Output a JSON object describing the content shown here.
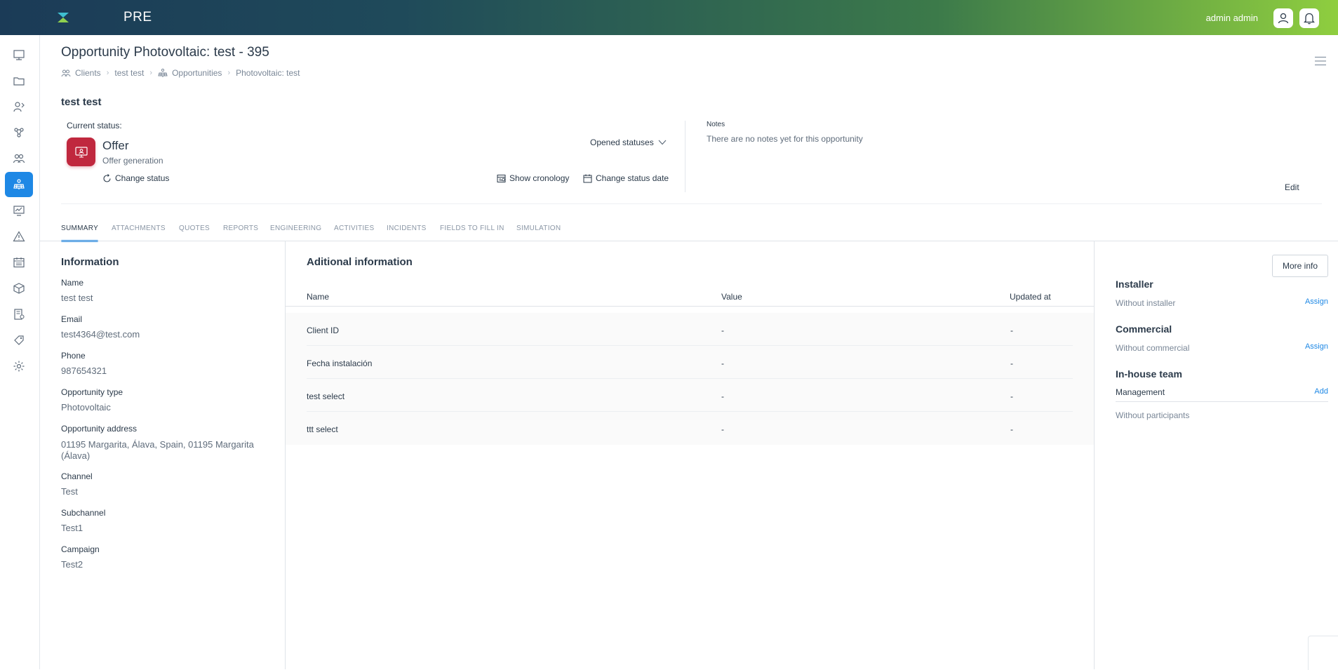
{
  "topbar": {
    "brand": "PRE",
    "user_name": "admin admin"
  },
  "sidebar": {
    "items": [
      {
        "icon": "dashboard-icon"
      },
      {
        "icon": "folder-icon"
      },
      {
        "icon": "leads-icon"
      },
      {
        "icon": "network-icon"
      },
      {
        "icon": "clients-icon"
      },
      {
        "icon": "solar-panel-icon",
        "active": true
      },
      {
        "icon": "monitor-icon"
      },
      {
        "icon": "warning-icon"
      },
      {
        "icon": "calendar-icon"
      },
      {
        "icon": "box-icon"
      },
      {
        "icon": "invoice-icon"
      },
      {
        "icon": "tag-icon"
      },
      {
        "icon": "settings-icon"
      }
    ]
  },
  "header": {
    "title": "Opportunity Photovoltaic: test - 395",
    "breadcrumb": [
      "Clients",
      "test test",
      "Opportunities",
      "Photovoltaic: test"
    ],
    "client_name": "test test"
  },
  "status": {
    "current_label": "Current status:",
    "name": "Offer",
    "sub": "Offer generation",
    "change_status": "Change status",
    "opened_statuses": "Opened statuses",
    "show_cronology": "Show cronology",
    "change_status_date": "Change status date",
    "color": "#c0283e"
  },
  "notes": {
    "label": "Notes",
    "text": "There are no notes yet for this opportunity",
    "edit": "Edit"
  },
  "tabs": [
    "SUMMARY",
    "ATTACHMENTS",
    "QUOTES",
    "REPORTS",
    "ENGINEERING",
    "ACTIVITIES",
    "INCIDENTS",
    "FIELDS TO FILL IN",
    "SIMULATION"
  ],
  "information": {
    "title": "Information",
    "fields": [
      {
        "label": "Name",
        "value": "test test"
      },
      {
        "label": "Email",
        "value": "test4364@test.com"
      },
      {
        "label": "Phone",
        "value": "987654321"
      },
      {
        "label": "Opportunity type",
        "value": "Photovoltaic"
      },
      {
        "label": "Opportunity address",
        "value": "01195 Margarita, Álava, Spain, 01195 Margarita (Álava)"
      },
      {
        "label": "Channel",
        "value": "Test"
      },
      {
        "label": "Subchannel",
        "value": "Test1"
      },
      {
        "label": "Campaign",
        "value": "Test2"
      }
    ]
  },
  "additional": {
    "title": "Aditional information",
    "columns": [
      "Name",
      "Value",
      "Updated at"
    ],
    "rows": [
      [
        "Client ID",
        "-",
        "-"
      ],
      [
        "Fecha instalación",
        "-",
        "-"
      ],
      [
        "test select",
        "-",
        "-"
      ],
      [
        "ttt select",
        "-",
        "-"
      ]
    ]
  },
  "right": {
    "more_info": "More info",
    "installer": {
      "title": "Installer",
      "text": "Without installer",
      "action": "Assign"
    },
    "commercial": {
      "title": "Commercial",
      "text": "Without commercial",
      "action": "Assign"
    },
    "team": {
      "title": "In-house team",
      "sub": "Management",
      "action": "Add",
      "text": "Without participants"
    }
  },
  "colors": {
    "accent": "#1e88e5"
  }
}
